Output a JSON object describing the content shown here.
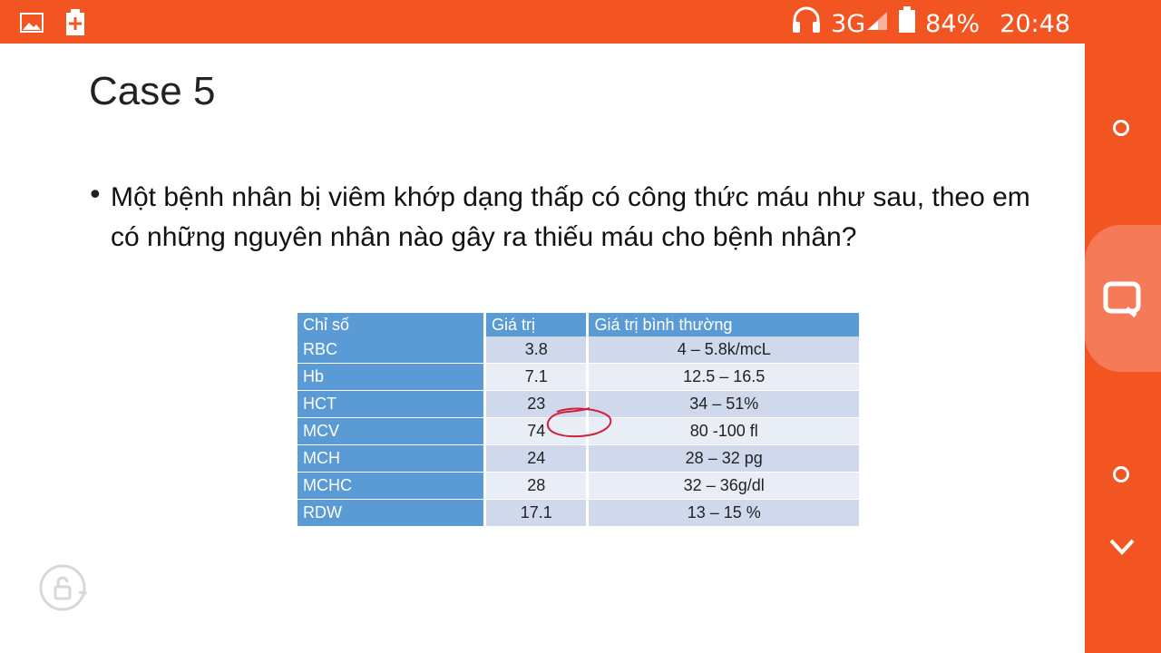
{
  "status_bar": {
    "network": "3G",
    "battery": "84%",
    "time": "20:48",
    "icons": [
      "image-icon",
      "battery-plus-icon",
      "headphones-icon",
      "signal-icon",
      "battery-icon"
    ]
  },
  "side_panel": {
    "icons": [
      "circle-icon",
      "edit-note-icon",
      "circle-icon",
      "chevron-down-icon"
    ]
  },
  "slide": {
    "title": "Case 5",
    "bullet": "Một bệnh nhân bị viêm khớp dạng thấp có công thức máu như sau, theo em có những nguyên nhân nào gây ra thiếu máu cho bệnh nhân?",
    "table": {
      "headers": [
        "Chỉ số",
        "Giá trị",
        "Giá trị bình thường"
      ],
      "rows": [
        {
          "name": "RBC",
          "value": "3.8",
          "normal": "4 – 5.8k/mcL"
        },
        {
          "name": "Hb",
          "value": "7.1",
          "normal": "12.5 – 16.5"
        },
        {
          "name": "HCT",
          "value": "23",
          "normal": "34 – 51%"
        },
        {
          "name": "MCV",
          "value": "74",
          "normal": "80 -100 fl"
        },
        {
          "name": "MCH",
          "value": "24",
          "normal": "28 – 32 pg"
        },
        {
          "name": "MCHC",
          "value": "28",
          "normal": "32 – 36g/dl"
        },
        {
          "name": "RDW",
          "value": "17.1",
          "normal": "13 – 15 %"
        }
      ]
    }
  },
  "colors": {
    "accent": "#f25522",
    "table_header": "#5b9bd5",
    "annotation": "#d0203a"
  }
}
